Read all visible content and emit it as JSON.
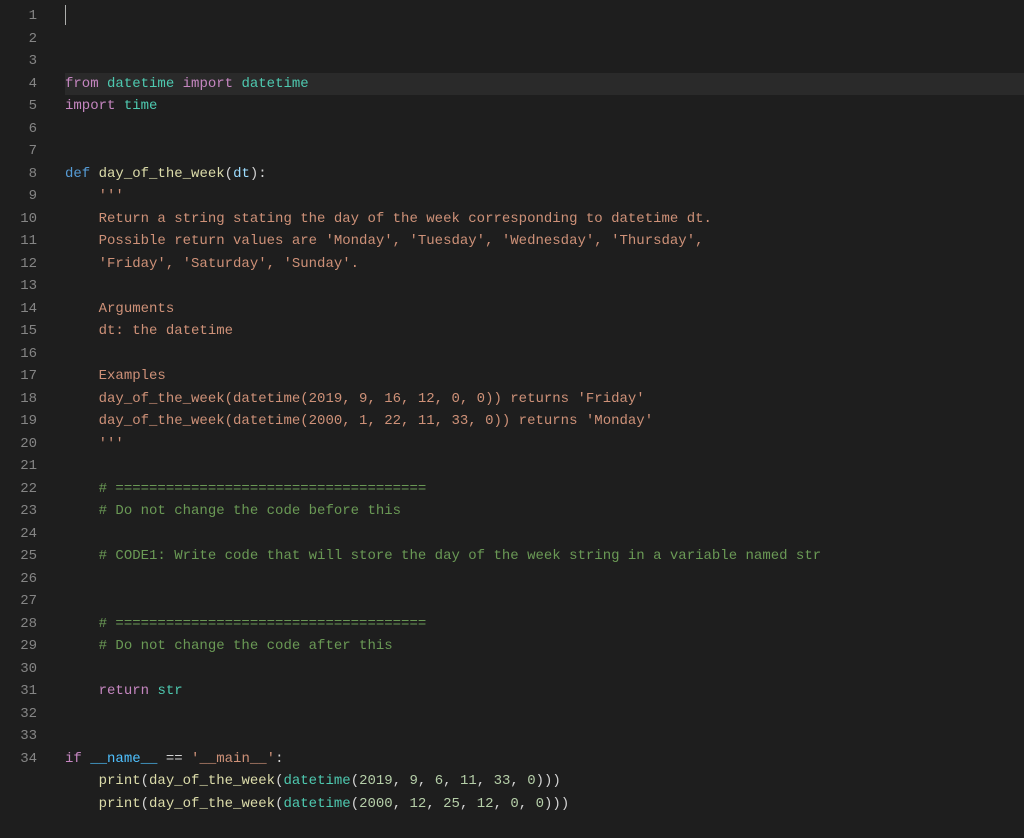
{
  "editor": {
    "language": "python",
    "cursor_line": 1,
    "cursor_col": 0,
    "line_count": 34,
    "lines": [
      {
        "n": 1,
        "tokens": [
          [
            "kw",
            "from"
          ],
          [
            "op",
            " "
          ],
          [
            "mod",
            "datetime"
          ],
          [
            "op",
            " "
          ],
          [
            "kw",
            "import"
          ],
          [
            "op",
            " "
          ],
          [
            "mod",
            "datetime"
          ]
        ]
      },
      {
        "n": 2,
        "tokens": [
          [
            "kw",
            "import"
          ],
          [
            "op",
            " "
          ],
          [
            "mod",
            "time"
          ]
        ]
      },
      {
        "n": 3,
        "tokens": []
      },
      {
        "n": 4,
        "tokens": []
      },
      {
        "n": 5,
        "tokens": [
          [
            "def",
            "def"
          ],
          [
            "op",
            " "
          ],
          [
            "fn",
            "day_of_the_week"
          ],
          [
            "punct",
            "("
          ],
          [
            "var",
            "dt"
          ],
          [
            "punct",
            "):"
          ]
        ]
      },
      {
        "n": 6,
        "tokens": [
          [
            "op",
            "    "
          ],
          [
            "str",
            "'''"
          ]
        ]
      },
      {
        "n": 7,
        "tokens": [
          [
            "op",
            "    "
          ],
          [
            "str",
            "Return a string stating the day of the week corresponding to datetime dt."
          ]
        ]
      },
      {
        "n": 8,
        "tokens": [
          [
            "op",
            "    "
          ],
          [
            "str",
            "Possible return values are 'Monday', 'Tuesday', 'Wednesday', 'Thursday',"
          ]
        ]
      },
      {
        "n": 9,
        "tokens": [
          [
            "op",
            "    "
          ],
          [
            "str",
            "'Friday', 'Saturday', 'Sunday'."
          ]
        ]
      },
      {
        "n": 10,
        "tokens": []
      },
      {
        "n": 11,
        "tokens": [
          [
            "op",
            "    "
          ],
          [
            "str",
            "Arguments"
          ]
        ]
      },
      {
        "n": 12,
        "tokens": [
          [
            "op",
            "    "
          ],
          [
            "str",
            "dt: the datetime"
          ]
        ]
      },
      {
        "n": 13,
        "tokens": []
      },
      {
        "n": 14,
        "tokens": [
          [
            "op",
            "    "
          ],
          [
            "str",
            "Examples"
          ]
        ]
      },
      {
        "n": 15,
        "tokens": [
          [
            "op",
            "    "
          ],
          [
            "str",
            "day_of_the_week(datetime(2019, 9, 16, 12, 0, 0)) returns 'Friday'"
          ]
        ]
      },
      {
        "n": 16,
        "tokens": [
          [
            "op",
            "    "
          ],
          [
            "str",
            "day_of_the_week(datetime(2000, 1, 22, 11, 33, 0)) returns 'Monday'"
          ]
        ]
      },
      {
        "n": 17,
        "tokens": [
          [
            "op",
            "    "
          ],
          [
            "str",
            "'''"
          ]
        ]
      },
      {
        "n": 18,
        "tokens": []
      },
      {
        "n": 19,
        "tokens": [
          [
            "op",
            "    "
          ],
          [
            "cmt",
            "# ====================================="
          ]
        ]
      },
      {
        "n": 20,
        "tokens": [
          [
            "op",
            "    "
          ],
          [
            "cmt",
            "# Do not change the code before this"
          ]
        ]
      },
      {
        "n": 21,
        "tokens": []
      },
      {
        "n": 22,
        "tokens": [
          [
            "op",
            "    "
          ],
          [
            "cmt",
            "# CODE1: Write code that will store the day of the week string in a variable named str"
          ]
        ]
      },
      {
        "n": 23,
        "tokens": []
      },
      {
        "n": 24,
        "tokens": []
      },
      {
        "n": 25,
        "tokens": [
          [
            "op",
            "    "
          ],
          [
            "cmt",
            "# ====================================="
          ]
        ]
      },
      {
        "n": 26,
        "tokens": [
          [
            "op",
            "    "
          ],
          [
            "cmt",
            "# Do not change the code after this"
          ]
        ]
      },
      {
        "n": 27,
        "tokens": []
      },
      {
        "n": 28,
        "tokens": [
          [
            "op",
            "    "
          ],
          [
            "kw",
            "return"
          ],
          [
            "op",
            " "
          ],
          [
            "builtin",
            "str"
          ]
        ]
      },
      {
        "n": 29,
        "tokens": []
      },
      {
        "n": 30,
        "tokens": []
      },
      {
        "n": 31,
        "tokens": [
          [
            "kw",
            "if"
          ],
          [
            "op",
            " "
          ],
          [
            "const",
            "__name__"
          ],
          [
            "op",
            " == "
          ],
          [
            "str",
            "'__main__'"
          ],
          [
            "punct",
            ":"
          ]
        ]
      },
      {
        "n": 32,
        "tokens": [
          [
            "op",
            "    "
          ],
          [
            "fn",
            "print"
          ],
          [
            "punct",
            "("
          ],
          [
            "fn",
            "day_of_the_week"
          ],
          [
            "punct",
            "("
          ],
          [
            "builtin",
            "datetime"
          ],
          [
            "punct",
            "("
          ],
          [
            "num",
            "2019"
          ],
          [
            "punct",
            ", "
          ],
          [
            "num",
            "9"
          ],
          [
            "punct",
            ", "
          ],
          [
            "num",
            "6"
          ],
          [
            "punct",
            ", "
          ],
          [
            "num",
            "11"
          ],
          [
            "punct",
            ", "
          ],
          [
            "num",
            "33"
          ],
          [
            "punct",
            ", "
          ],
          [
            "num",
            "0"
          ],
          [
            "punct",
            ")))"
          ]
        ]
      },
      {
        "n": 33,
        "tokens": [
          [
            "op",
            "    "
          ],
          [
            "fn",
            "print"
          ],
          [
            "punct",
            "("
          ],
          [
            "fn",
            "day_of_the_week"
          ],
          [
            "punct",
            "("
          ],
          [
            "builtin",
            "datetime"
          ],
          [
            "punct",
            "("
          ],
          [
            "num",
            "2000"
          ],
          [
            "punct",
            ", "
          ],
          [
            "num",
            "12"
          ],
          [
            "punct",
            ", "
          ],
          [
            "num",
            "25"
          ],
          [
            "punct",
            ", "
          ],
          [
            "num",
            "12"
          ],
          [
            "punct",
            ", "
          ],
          [
            "num",
            "0"
          ],
          [
            "punct",
            ", "
          ],
          [
            "num",
            "0"
          ],
          [
            "punct",
            ")))"
          ]
        ]
      },
      {
        "n": 34,
        "tokens": []
      }
    ]
  }
}
